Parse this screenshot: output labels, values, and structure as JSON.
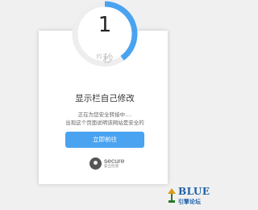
{
  "countdown": {
    "value": "1",
    "unit_prefix": "约",
    "unit": "秒",
    "progress": 0.4,
    "ring_track_color": "#eeeeee",
    "ring_progress_color": "#4aa3f0"
  },
  "page_title": "显示栏自己修改",
  "desc_line1": "正在为您安全转接中....",
  "desc_line2": "出现这个页面说明该网站是安全的",
  "go_button_label": "立即前往",
  "secure_badge": {
    "label": "secure",
    "sub": "安全检测"
  },
  "watermark": {
    "brand": "BLUE",
    "sub": "引擎论坛"
  }
}
